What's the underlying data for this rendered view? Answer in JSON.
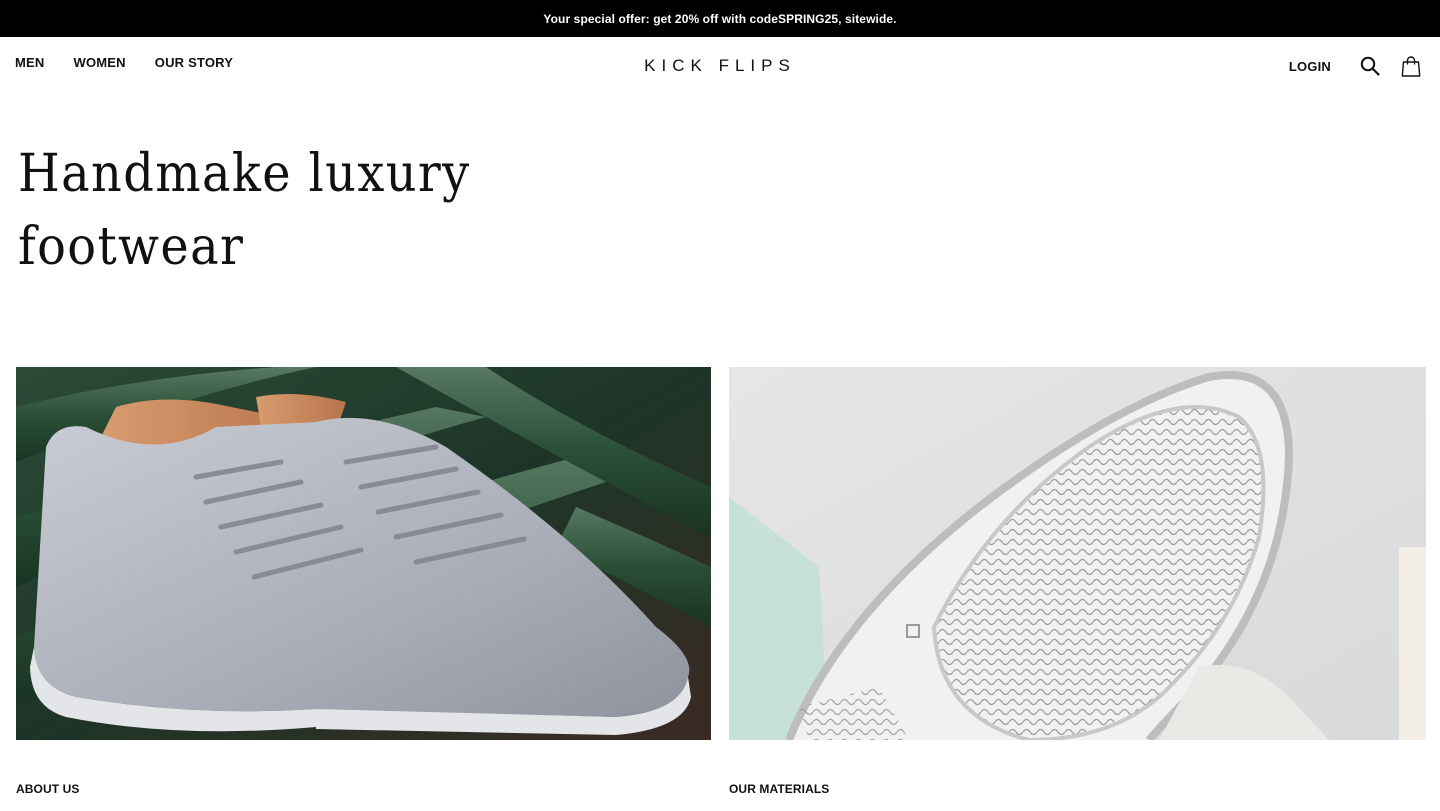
{
  "promo": {
    "prefix": "Your special offer: get 20% off with code ",
    "code": "SPRING25",
    "suffix": ", sitewide."
  },
  "nav": {
    "links": [
      "MEN",
      "WOMEN",
      "OUR STORY"
    ],
    "brand": "KICK FLIPS",
    "login": "LOGIN",
    "icons": [
      "search-icon",
      "shopping-bag-icon"
    ]
  },
  "hero": {
    "title": "Handmake luxury footwear"
  },
  "tiles": [
    {
      "caption": "ABOUT US",
      "image": "grey leather sneakers on green bench"
    },
    {
      "caption": "OUR MATERIALS",
      "image": "white sneaker sole close-up"
    }
  ],
  "colors": {
    "promo_bg": "#000000",
    "promo_text": "#ffffff",
    "text": "#111111",
    "background": "#ffffff"
  }
}
